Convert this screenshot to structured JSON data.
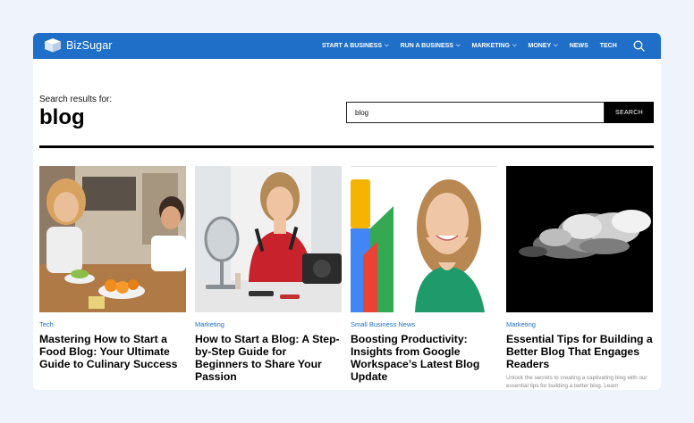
{
  "brand": {
    "name": "BizSugar"
  },
  "nav": [
    {
      "label": "START A BUSINESS",
      "chevron": true
    },
    {
      "label": "RUN A BUSINESS",
      "chevron": true
    },
    {
      "label": "MARKETING",
      "chevron": true
    },
    {
      "label": "MONEY",
      "chevron": true
    },
    {
      "label": "NEWS",
      "chevron": false
    },
    {
      "label": "TECH",
      "chevron": false
    }
  ],
  "search": {
    "results_label": "Search results for:",
    "query": "blog",
    "input_value": "blog",
    "button_label": "SEARCH"
  },
  "articles": [
    {
      "category": "Tech",
      "title": "Mastering How to Start a Food Blog: Your Ultimate Guide to Culinary Success",
      "excerpt": ""
    },
    {
      "category": "Marketing",
      "title": "How to Start a Blog: A Step-by-Step Guide for Beginners to Share Your Passion",
      "excerpt": ""
    },
    {
      "category": "Small Business News",
      "title": "Boosting Productivity: Insights from Google Workspace’s Latest Blog Update",
      "excerpt": ""
    },
    {
      "category": "Marketing",
      "title": "Essential Tips for Building a Better Blog That Engages Readers",
      "excerpt": "Unlock the secrets to creating a captivating blog with our essential tips for building a better blog. Learn"
    }
  ],
  "colors": {
    "brand_blue": "#1f6fc8",
    "page_bg": "#eef3fc"
  }
}
